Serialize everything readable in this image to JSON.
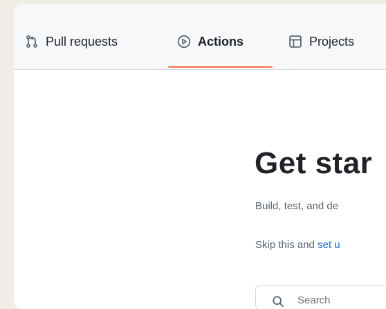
{
  "tabs": {
    "pull_requests": "Pull requests",
    "actions": "Actions",
    "projects": "Projects",
    "icons": {
      "pull_requests": "git-pull-request-icon",
      "actions": "play-circle-icon",
      "projects": "table-icon"
    },
    "active": "Actions"
  },
  "main": {
    "heading": "Get star",
    "description": "Build, test, and de",
    "skip_prefix": "Skip this and ",
    "skip_link": "set u",
    "search_placeholder": "Search"
  },
  "colors": {
    "active_underline": "#fd8c73",
    "link": "#0969da",
    "muted_text": "#59636e",
    "text": "#1f2328"
  }
}
